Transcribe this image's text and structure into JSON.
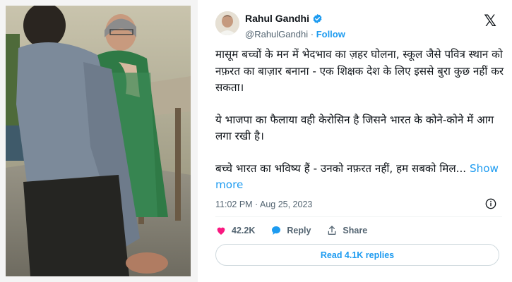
{
  "tweet": {
    "author_name": "Rahul Gandhi",
    "handle": "@RahulGandhi",
    "separator": "·",
    "follow_label": "Follow",
    "paragraph1": "मासूम बच्चों के मन में भेदभाव का ज़हर घोलना, स्कूल जैसे पवित्र स्थान को नफ़रत का बाज़ार बनाना - एक शिक्षक देश के लिए इससे बुरा कुछ नहीं कर सकता।",
    "paragraph2": "ये भाजपा का फैलाया वही केरोसिन है जिसने भारत के कोने-कोने में आग लगा रखी है।",
    "paragraph3": "बच्चे भारत का भविष्य हैं - उनको नफ़रत नहीं, हम सबको मिल...",
    "show_more": "Show more",
    "timestamp": "11:02 PM · Aug 25, 2023",
    "likes": "42.2K",
    "reply_label": "Reply",
    "share_label": "Share",
    "replies_button": "Read 4.1K replies"
  },
  "icons": {
    "verified": "verified-badge-icon",
    "x_logo": "x-logo-icon",
    "info": "info-icon",
    "like": "heart-icon",
    "reply": "reply-bubble-icon",
    "share": "share-upload-icon"
  },
  "colors": {
    "accent": "#1d9bf0",
    "like": "#f91880",
    "text": "#0f1419",
    "secondary": "#536471"
  }
}
